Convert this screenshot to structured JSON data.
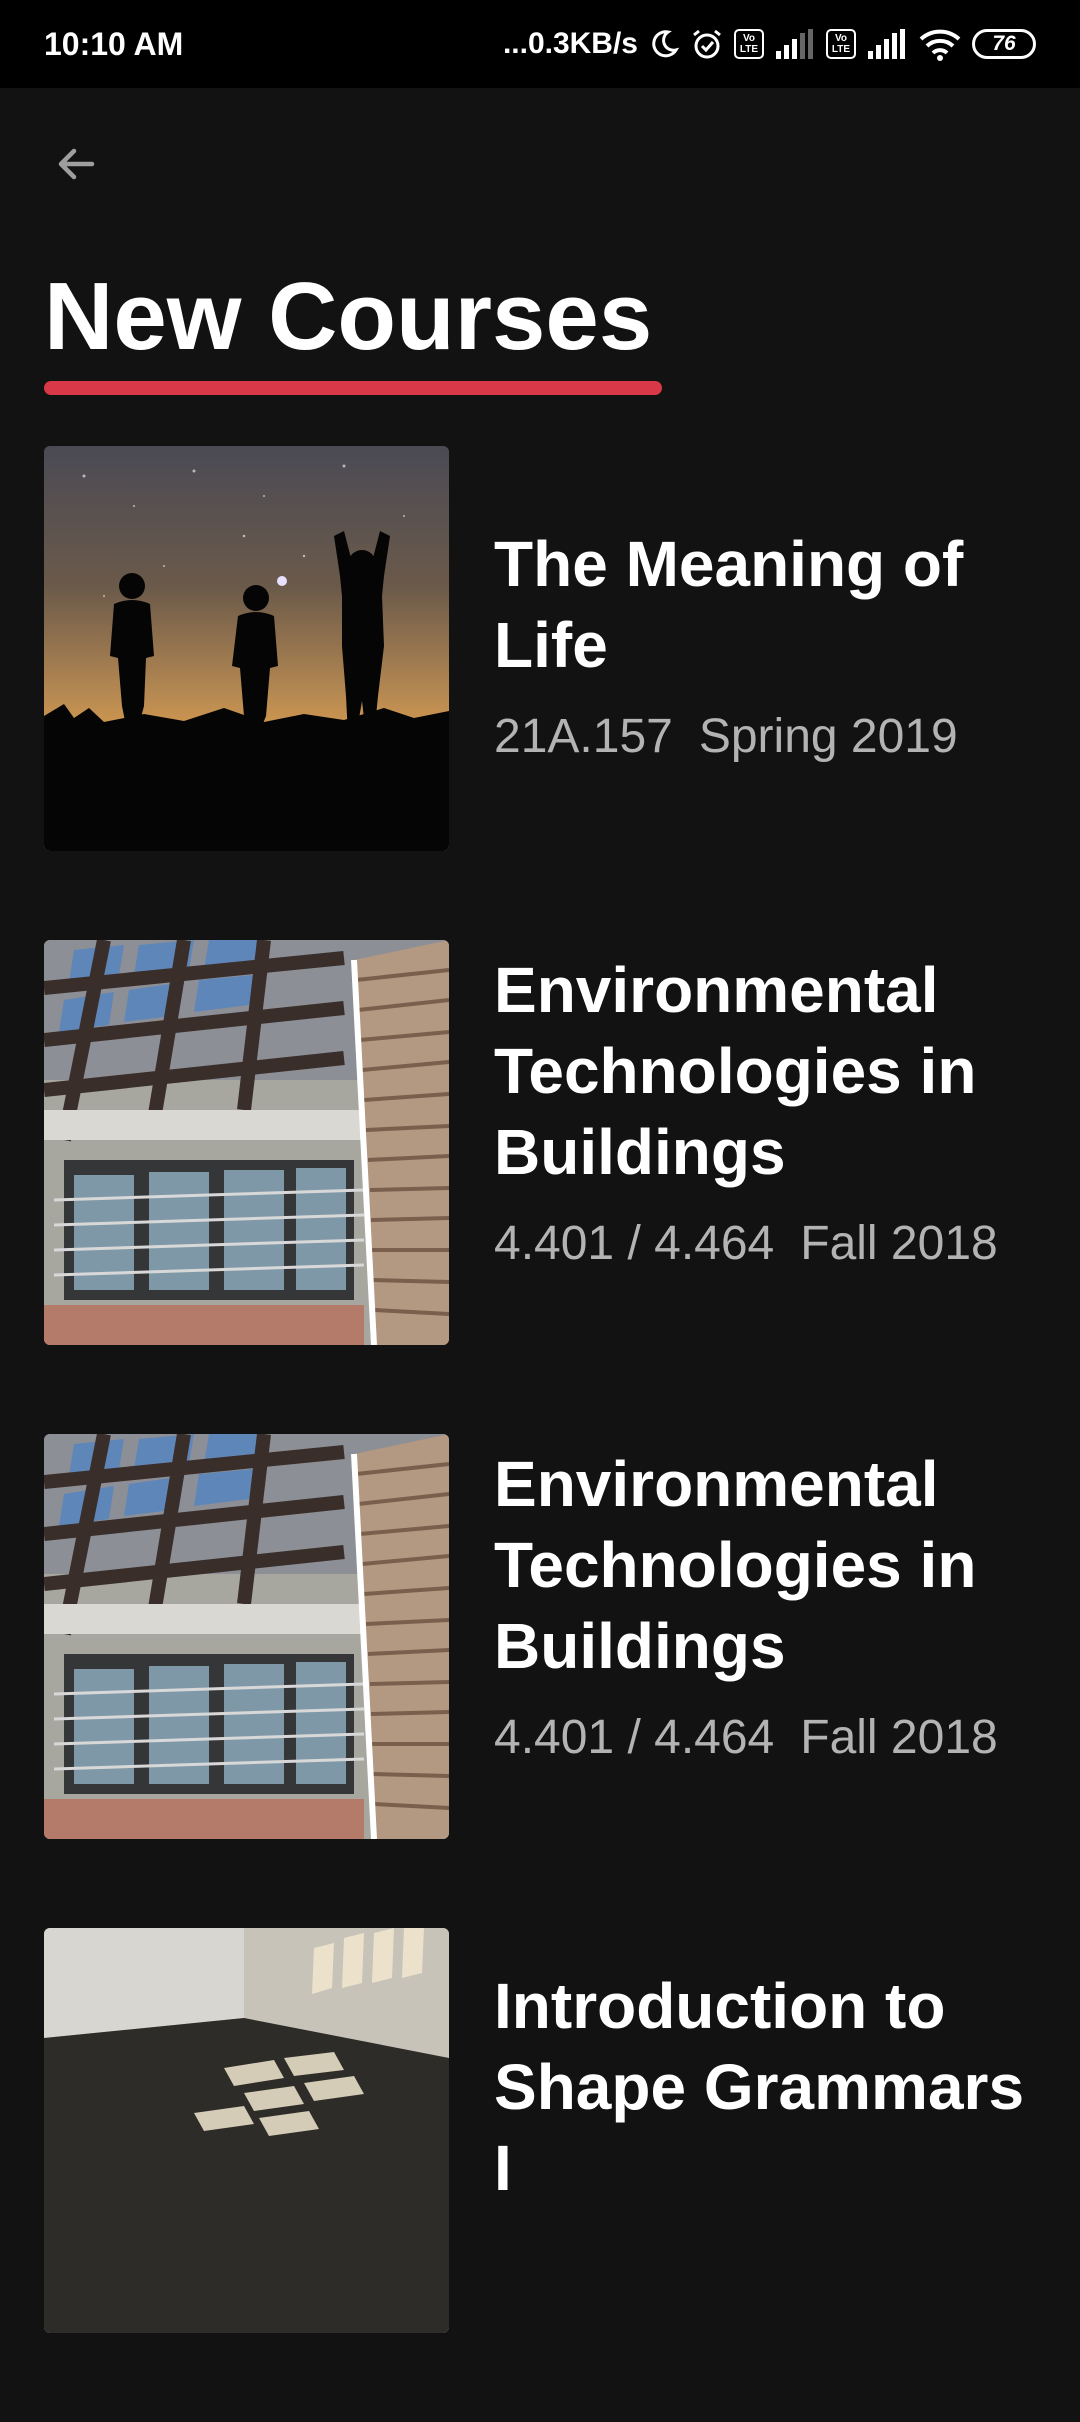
{
  "status_bar": {
    "time": "10:10 AM",
    "net_speed": "...0.3KB/s",
    "volte_label": "Vo LTE",
    "battery": "76"
  },
  "header": {
    "back_icon": "arrow-left-icon",
    "title": "New Courses",
    "accent_color": "#d93848"
  },
  "courses": [
    {
      "title": "The Meaning of Life",
      "number": "21A.157",
      "term": "Spring 2019",
      "image": "night-sky-silhouettes"
    },
    {
      "title": "Environmental Technologies in Buildings",
      "number": "4.401 / 4.464",
      "term": "Fall 2018",
      "image": "building-facade-pergola"
    },
    {
      "title": "Environmental Technologies in Buildings",
      "number": "4.401 / 4.464",
      "term": "Fall 2018",
      "image": "building-facade-pergola"
    },
    {
      "title": "Introduction to Shape Grammars I",
      "number": "",
      "term": "",
      "image": "room-corner-light-pattern"
    }
  ]
}
